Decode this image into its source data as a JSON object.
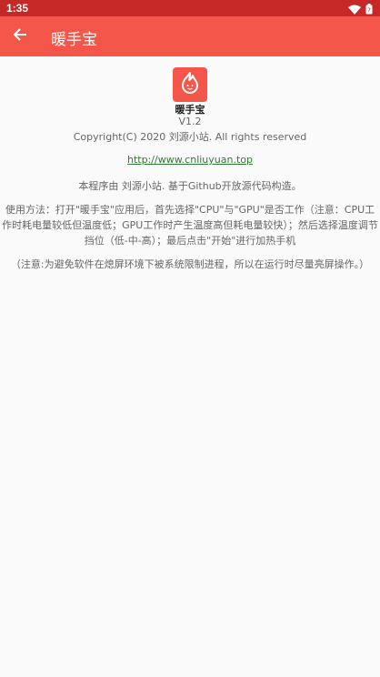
{
  "status_bar": {
    "time": "1:35",
    "wifi_icon": "wifi-icon",
    "battery_icon": "battery-icon"
  },
  "app_bar": {
    "back_icon": "arrow-back-icon",
    "title": "暖手宝",
    "background_color": "#f4574a"
  },
  "about": {
    "logo_icon": "flame-icon",
    "app_name": "暖手宝",
    "version": "V1.2",
    "copyright": "Copyright(C) 2020 刘源小站. All rights reserved",
    "website": "http://www.cnliuyuan.top",
    "intro": "本程序由 刘源小站. 基于Github开放源代码构造。",
    "usage": "使用方法：打开\"暖手宝\"应用后，首先选择\"CPU\"与\"GPU\"是否工作（注意：CPU工作时耗电量较低但温度低；GPU工作时产生温度高但耗电量较快）；然后选择温度调节挡位（低-中-高）；最后点击\"开始\"进行加热手机",
    "note": "（注意:为避免软件在熄屏环境下被系统限制进程，所以在运行时尽量亮屏操作。）"
  }
}
